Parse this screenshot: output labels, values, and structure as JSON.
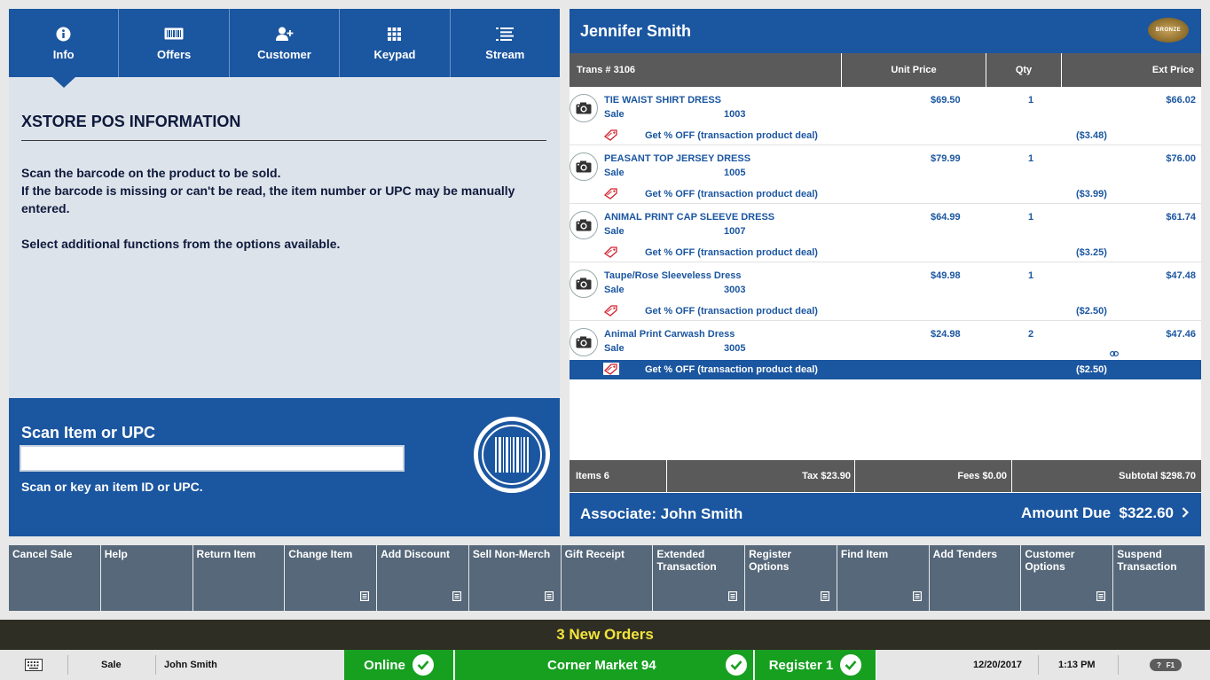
{
  "tabs": [
    {
      "label": "Info",
      "icon": "info-icon"
    },
    {
      "label": "Offers",
      "icon": "offers-icon"
    },
    {
      "label": "Customer",
      "icon": "add-customer-icon"
    },
    {
      "label": "Keypad",
      "icon": "keypad-icon"
    },
    {
      "label": "Stream",
      "icon": "stream-icon"
    }
  ],
  "info": {
    "title": "XSTORE POS INFORMATION",
    "line1": "Scan the barcode on the product to be sold.",
    "line2": "If the barcode is missing or can't be read, the item number or UPC may be manually entered.",
    "line3": "Select additional functions from the options available."
  },
  "scan": {
    "title": "Scan Item or UPC",
    "value": "",
    "hint": "Scan or key an item ID or UPC."
  },
  "customer": {
    "name": "Jennifer Smith",
    "tier": "BRONZE"
  },
  "columns": {
    "trans": "Trans # 3106",
    "unit": "Unit Price",
    "qty": "Qty",
    "ext": "Ext Price"
  },
  "items": [
    {
      "name": "TIE WAIST SHIRT DRESS",
      "type": "Sale",
      "id": "1003",
      "unit": "$69.50",
      "qty": "1",
      "ext": "$66.02",
      "deal": "Get % OFF (transaction product deal)",
      "deal_amt": "($3.48)"
    },
    {
      "name": "PEASANT TOP JERSEY DRESS",
      "type": "Sale",
      "id": "1005",
      "unit": "$79.99",
      "qty": "1",
      "ext": "$76.00",
      "deal": "Get % OFF (transaction product deal)",
      "deal_amt": "($3.99)"
    },
    {
      "name": "ANIMAL PRINT CAP SLEEVE DRESS",
      "type": "Sale",
      "id": "1007",
      "unit": "$64.99",
      "qty": "1",
      "ext": "$61.74",
      "deal": "Get % OFF (transaction product deal)",
      "deal_amt": "($3.25)"
    },
    {
      "name": "Taupe/Rose Sleeveless Dress",
      "type": "Sale",
      "id": "3003",
      "unit": "$49.98",
      "qty": "1",
      "ext": "$47.48",
      "deal": "Get % OFF (transaction product deal)",
      "deal_amt": "($2.50)"
    },
    {
      "name": "Animal Print Carwash Dress",
      "type": "Sale",
      "id": "3005",
      "unit": "$24.98",
      "qty": "2",
      "ext": "$47.46",
      "deal": "Get % OFF (transaction product deal)",
      "deal_amt": "($2.50)"
    }
  ],
  "totals": {
    "items": "Items 6",
    "tax": "Tax $23.90",
    "fees": "Fees $0.00",
    "subtotal": "Subtotal $298.70"
  },
  "footer": {
    "associate": "Associate: John Smith",
    "amount_due": "Amount Due  $322.60"
  },
  "functions": [
    {
      "label": "Cancel Sale",
      "menu": false
    },
    {
      "label": "Help",
      "menu": false
    },
    {
      "label": "Return Item",
      "menu": false
    },
    {
      "label": "Change Item",
      "menu": true
    },
    {
      "label": "Add Discount",
      "menu": true
    },
    {
      "label": "Sell Non-Merch",
      "menu": true
    },
    {
      "label": "Gift Receipt",
      "menu": false
    },
    {
      "label": "Extended Transaction",
      "menu": true
    },
    {
      "label": "Register Options",
      "menu": true
    },
    {
      "label": "Find Item",
      "menu": true
    },
    {
      "label": "Add Tenders",
      "menu": false
    },
    {
      "label": "Customer Options",
      "menu": true
    },
    {
      "label": "Suspend Transaction",
      "menu": false
    }
  ],
  "orders": "3 New Orders",
  "status": {
    "mode": "Sale",
    "user": "John Smith",
    "online": "Online",
    "store": "Corner Market 94",
    "register": "Register 1",
    "date": "12/20/2017",
    "time": "1:13 PM",
    "help_q": "?",
    "help_key": "F1"
  },
  "colors": {
    "primary": "#1b56a0",
    "function_btn": "#56687a",
    "status_ok": "#17a020",
    "orders_text": "#f3e43a"
  }
}
